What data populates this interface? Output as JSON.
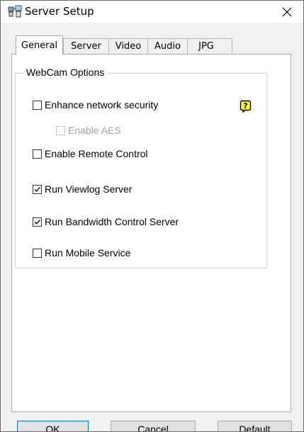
{
  "window": {
    "title": "Server Setup",
    "close_glyph": "X"
  },
  "tabs": [
    {
      "label": "General",
      "active": true
    },
    {
      "label": "Server",
      "active": false
    },
    {
      "label": "Video",
      "active": false
    },
    {
      "label": "Audio",
      "active": false
    },
    {
      "label": "JPG",
      "active": false
    }
  ],
  "webcam_options": {
    "group_label": "WebCam Options",
    "options": [
      {
        "label": "Enhance network security",
        "checked": false,
        "enabled": true
      },
      {
        "label": "Enable AES",
        "checked": false,
        "enabled": false
      },
      {
        "label": "Enable Remote Control",
        "checked": false,
        "enabled": true
      },
      {
        "label": "Run Viewlog Server",
        "checked": true,
        "enabled": true
      },
      {
        "label": "Run Bandwidth Control Server",
        "checked": true,
        "enabled": true
      },
      {
        "label": "Run Mobile Service",
        "checked": false,
        "enabled": true
      }
    ],
    "help_icon": "help-question-icon"
  },
  "buttons": {
    "ok": "OK",
    "cancel": "Cancel",
    "default": "Default"
  },
  "colors": {
    "help_icon_fill": "#ffff00",
    "focus_border": "#0078d7"
  }
}
